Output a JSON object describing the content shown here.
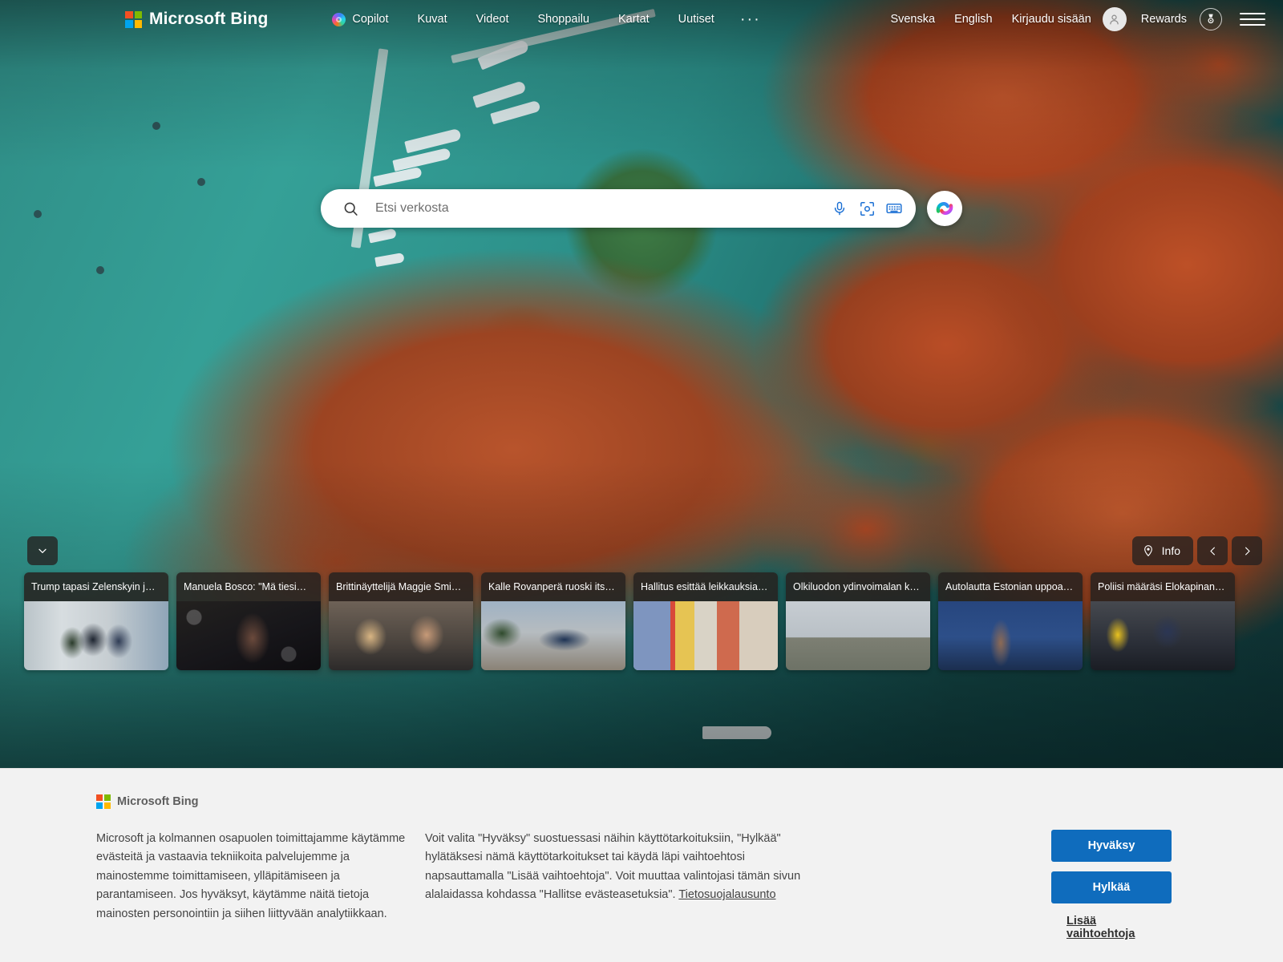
{
  "header": {
    "brand": "Microsoft Bing",
    "nav": [
      {
        "label": "Copilot",
        "icon": "copilot-icon"
      },
      {
        "label": "Kuvat"
      },
      {
        "label": "Videot"
      },
      {
        "label": "Shoppailu"
      },
      {
        "label": "Kartat"
      },
      {
        "label": "Uutiset"
      }
    ],
    "overflow": "···",
    "right": {
      "lang_primary": "Svenska",
      "lang_secondary": "English",
      "signin": "Kirjaudu sisään",
      "rewards": "Rewards",
      "avatar_icon": "person-icon",
      "rewards_icon": "medal-icon",
      "menu_icon": "hamburger-icon"
    }
  },
  "search": {
    "placeholder": "Etsi verkosta",
    "value": "",
    "search_icon": "search-icon",
    "mic_icon": "microphone-icon",
    "lens_icon": "visual-search-icon",
    "keyboard_icon": "keyboard-icon",
    "copilot_icon": "copilot-icon"
  },
  "hero": {
    "collapse_icon": "chevron-down-icon",
    "info_label": "Info",
    "info_icon": "location-pin-icon",
    "prev_icon": "chevron-left-icon",
    "next_icon": "chevron-right-icon"
  },
  "news_cards": [
    {
      "title": "Trump tapasi Zelenskyin j…",
      "art": "img-trump"
    },
    {
      "title": "Manuela Bosco: \"Mä tiesi…",
      "art": "img-bosco"
    },
    {
      "title": "Brittinäyttelijä Maggie Smi…",
      "art": "img-maggie"
    },
    {
      "title": "Kalle Rovanperä ruoski its…",
      "art": "img-rally"
    },
    {
      "title": "Hallitus esittää leikkauksia…",
      "art": "img-houses"
    },
    {
      "title": "Olkiluodon ydinvoimalan k…",
      "art": "img-nuclear"
    },
    {
      "title": "Autolautta Estonian uppoa…",
      "art": "img-estonia"
    },
    {
      "title": "Poliisi määräsi Elokapinan…",
      "art": "img-police"
    }
  ],
  "cookie": {
    "brand": "Microsoft Bing",
    "paragraph_left": "Microsoft ja kolmannen osapuolen toimittajamme käytämme evästeitä ja vastaavia tekniikoita palvelujemme ja mainostemme toimittamiseen, ylläpitämiseen ja parantamiseen. Jos hyväksyt, käytämme näitä tietoja mainosten personointiin ja siihen liittyvään analytiikkaan.",
    "paragraph_right": "Voit valita \"Hyväksy\" suostuessasi näihin käyttötarkoituksiin, \"Hylkää\" hylätäksesi nämä käyttötarkoitukset tai käydä läpi vaihtoehtosi napsauttamalla \"Lisää vaihtoehtoja\". Voit muuttaa valintojasi tämän sivun alalaidassa kohdassa \"Hallitse evästeasetuksia\". ",
    "privacy_link": "Tietosuojalausunto",
    "accept": "Hyväksy",
    "reject": "Hylkää",
    "more_options": "Lisää vaihtoehtoja"
  },
  "colors": {
    "accent_blue": "#0f6cbd",
    "overlay_dark": "rgba(38,34,32,0.8)",
    "banner_bg": "#f2f2f2"
  }
}
